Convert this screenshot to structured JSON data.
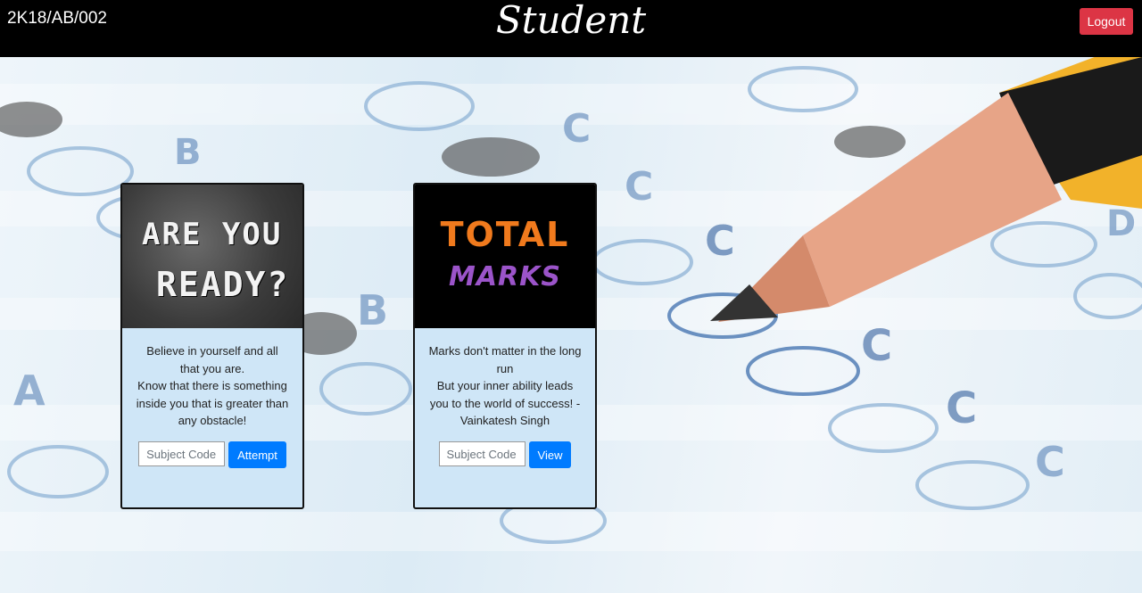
{
  "header": {
    "student_id": "2K18/AB/002",
    "title": "Student",
    "logout_label": "Logout"
  },
  "cards": [
    {
      "image_text_line1": "ARE YOU",
      "image_text_line2": "READY?",
      "text_lines": [
        "Believe in yourself and all",
        "that you are.",
        "Know that there is something",
        "inside you that is greater than",
        "any obstacle!"
      ],
      "input_placeholder": "Subject Code",
      "button_label": "Attempt"
    },
    {
      "image_text_line1": "TOTAL",
      "image_text_line2": "MARKS",
      "text_lines": [
        "Marks don't matter in the long",
        "run",
        "But your inner ability leads",
        "you to the world of success! -",
        "Vainkatesh Singh"
      ],
      "input_placeholder": "Subject Code",
      "button_label": "View"
    }
  ],
  "colors": {
    "header_bg": "#000000",
    "logout": "#dc3545",
    "primary": "#007bff",
    "card_bg": "#cfe6f7",
    "total_orange": "#f07a1d",
    "marks_purple": "#9b54c9"
  }
}
